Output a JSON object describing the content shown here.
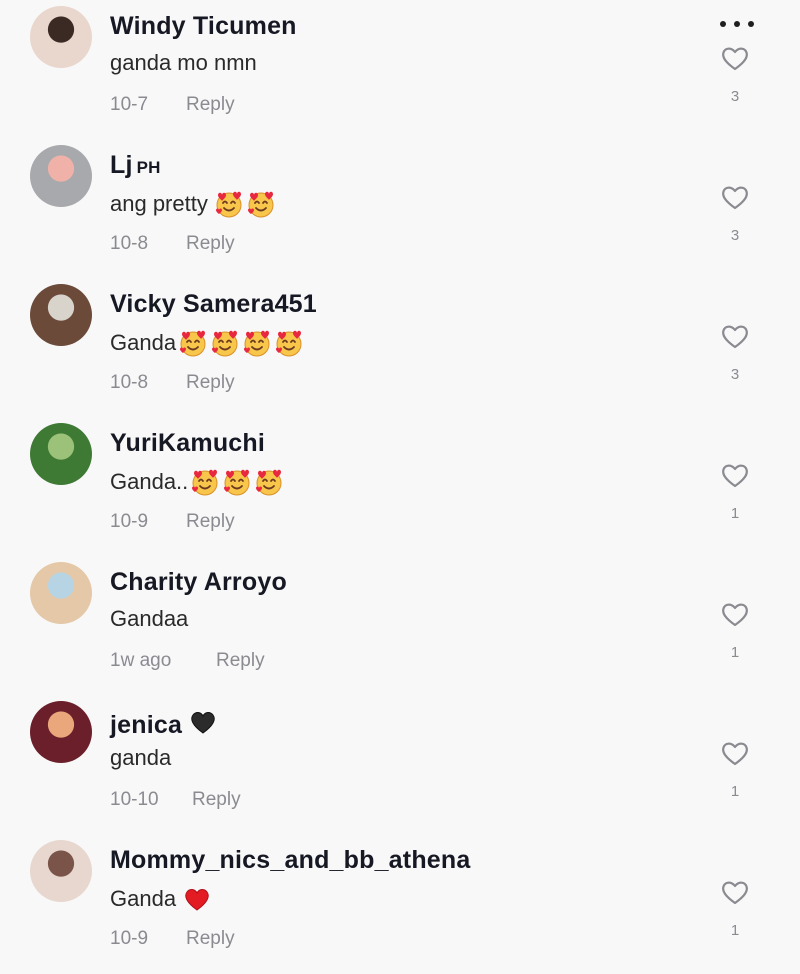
{
  "header": {
    "more_icon": "ellipsis-horizontal-icon"
  },
  "comments": [
    {
      "username": "Windy Ticumen",
      "badge": "",
      "text": "ganda mo nmn",
      "emojis": [],
      "date": "10-7",
      "reply": "Reply",
      "likes": "3",
      "avatar_colors": [
        "#e9d6cc",
        "#3b2a24"
      ]
    },
    {
      "username": "Lj",
      "badge": "PH",
      "text": "ang pretty",
      "emojis": [
        "smiling-hearts",
        "smiling-hearts"
      ],
      "date": "10-8",
      "reply": "Reply",
      "likes": "3",
      "avatar_colors": [
        "#a7a9ad",
        "#f0b2a8"
      ]
    },
    {
      "username": "Vicky Samera451",
      "badge": "",
      "text": "Ganda",
      "emojis": [
        "smiling-hearts",
        "smiling-hearts",
        "smiling-hearts",
        "smiling-hearts"
      ],
      "date": "10-8",
      "reply": "Reply",
      "likes": "3",
      "avatar_colors": [
        "#6c4a3a",
        "#d8d4cc"
      ]
    },
    {
      "username": "YuriKamuchi",
      "badge": "",
      "text": "Ganda..",
      "emojis": [
        "smiling-hearts",
        "smiling-hearts",
        "smiling-hearts"
      ],
      "date": "10-9",
      "reply": "Reply",
      "likes": "1",
      "avatar_colors": [
        "#3f7a35",
        "#9cc27a"
      ]
    },
    {
      "username": "Charity Arroyo",
      "badge": "",
      "text": "Gandaa",
      "emojis": [],
      "date": "1w ago",
      "reply": "Reply",
      "likes": "1",
      "avatar_colors": [
        "#e4c8a8",
        "#b7d4e4"
      ]
    },
    {
      "username": "jenica",
      "badge": "",
      "badge_icon": "black-heart",
      "text": "ganda",
      "emojis": [],
      "date": "10-10",
      "reply": "Reply",
      "likes": "1",
      "avatar_colors": [
        "#6b1f2a",
        "#e9a77b"
      ]
    },
    {
      "username": "Mommy_nics_and_bb_athena",
      "badge": "",
      "text": "Ganda",
      "emojis": [
        "red-heart"
      ],
      "date": "10-9",
      "reply": "Reply",
      "likes": "1",
      "avatar_colors": [
        "#e7d7cf",
        "#7a5448"
      ]
    }
  ],
  "icons": {
    "like": "heart-outline-icon",
    "emoji": "smiling-face-with-hearts-icon",
    "red_heart": "red-heart-icon",
    "black_heart": "black-heart-icon"
  },
  "colors": {
    "username": "#161823",
    "meta": "#8a8b91",
    "background": "#f8f8f8"
  }
}
